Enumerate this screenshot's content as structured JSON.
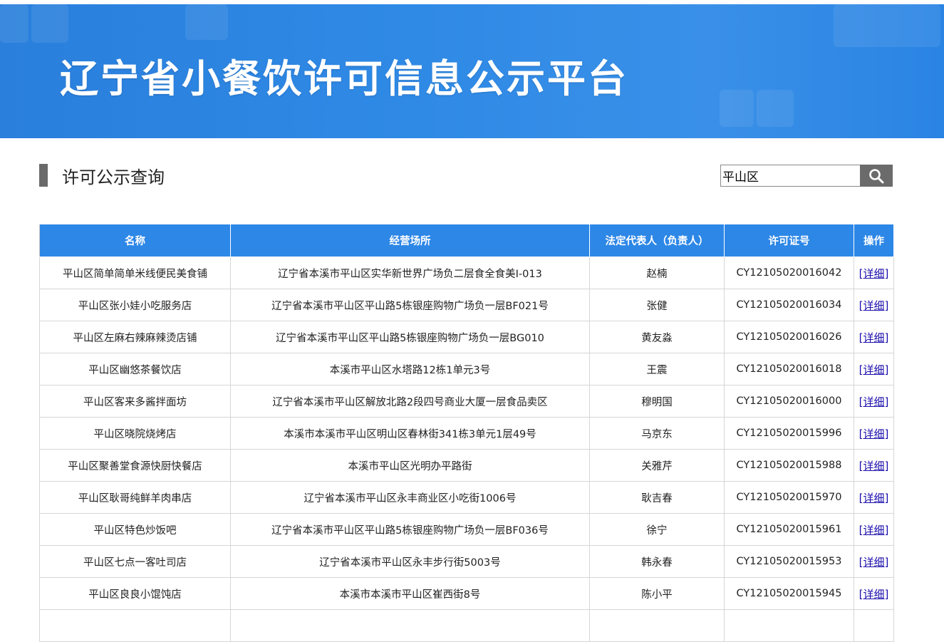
{
  "header": {
    "title": "辽宁省小餐饮许可信息公示平台"
  },
  "section": {
    "title": "许可公示查询"
  },
  "search": {
    "value": "平山区",
    "icon": "search-icon"
  },
  "table": {
    "columns": [
      "名称",
      "经营场所",
      "法定代表人（负责人）",
      "许可证号",
      "操作"
    ],
    "rows": [
      {
        "name": "平山区简单简单米线便民美食铺",
        "address": "辽宁省本溪市平山区实华新世界广场负二层食全食美I-013",
        "rep": "赵楠",
        "license": "CY12105020016042",
        "action": "[详细]"
      },
      {
        "name": "平山区张小娃小吃服务店",
        "address": "辽宁省本溪市平山区平山路5栋银座购物广场负一层BF021号",
        "rep": "张健",
        "license": "CY12105020016034",
        "action": "[详细]"
      },
      {
        "name": "平山区左麻右辣麻辣烫店铺",
        "address": "辽宁省本溪市平山区平山路5栋银座购物广场负一层BG010",
        "rep": "黄友淼",
        "license": "CY12105020016026",
        "action": "[详细]"
      },
      {
        "name": "平山区幽悠茶餐饮店",
        "address": "本溪市平山区水塔路12栋1单元3号",
        "rep": "王震",
        "license": "CY12105020016018",
        "action": "[详细]"
      },
      {
        "name": "平山区客来多酱拌面坊",
        "address": "辽宁省本溪市平山区解放北路2段四号商业大厦一层食品卖区",
        "rep": "穆明国",
        "license": "CY12105020016000",
        "action": "[详细]"
      },
      {
        "name": "平山区晓院烧烤店",
        "address": "本溪市本溪市平山区明山区春林街341栋3单元1层49号",
        "rep": "马京东",
        "license": "CY12105020015996",
        "action": "[详细]"
      },
      {
        "name": "平山区聚善堂食源快厨快餐店",
        "address": "本溪市平山区光明办平路街",
        "rep": "关雅芹",
        "license": "CY12105020015988",
        "action": "[详细]"
      },
      {
        "name": "平山区耿哥纯鲜羊肉串店",
        "address": "辽宁省本溪市平山区永丰商业区小吃街1006号",
        "rep": "耿吉春",
        "license": "CY12105020015970",
        "action": "[详细]"
      },
      {
        "name": "平山区特色炒饭吧",
        "address": "辽宁省本溪市平山区平山路5栋银座购物广场负一层BF036号",
        "rep": "徐宁",
        "license": "CY12105020015961",
        "action": "[详细]"
      },
      {
        "name": "平山区七点一客吐司店",
        "address": "辽宁省本溪市平山区永丰步行街5003号",
        "rep": "韩永春",
        "license": "CY12105020015953",
        "action": "[详细]"
      },
      {
        "name": "平山区良良小馄饨店",
        "address": "本溪市本溪市平山区崔西街8号",
        "rep": "陈小平",
        "license": "CY12105020015945",
        "action": "[详细]"
      },
      {
        "name": "",
        "address": "",
        "rep": "",
        "license": "",
        "action": ""
      }
    ]
  },
  "colors": {
    "banner": "#2f8ae6",
    "table_header": "#2d87e6",
    "link": "#1a0dab",
    "search_button": "#6b6b6b"
  }
}
